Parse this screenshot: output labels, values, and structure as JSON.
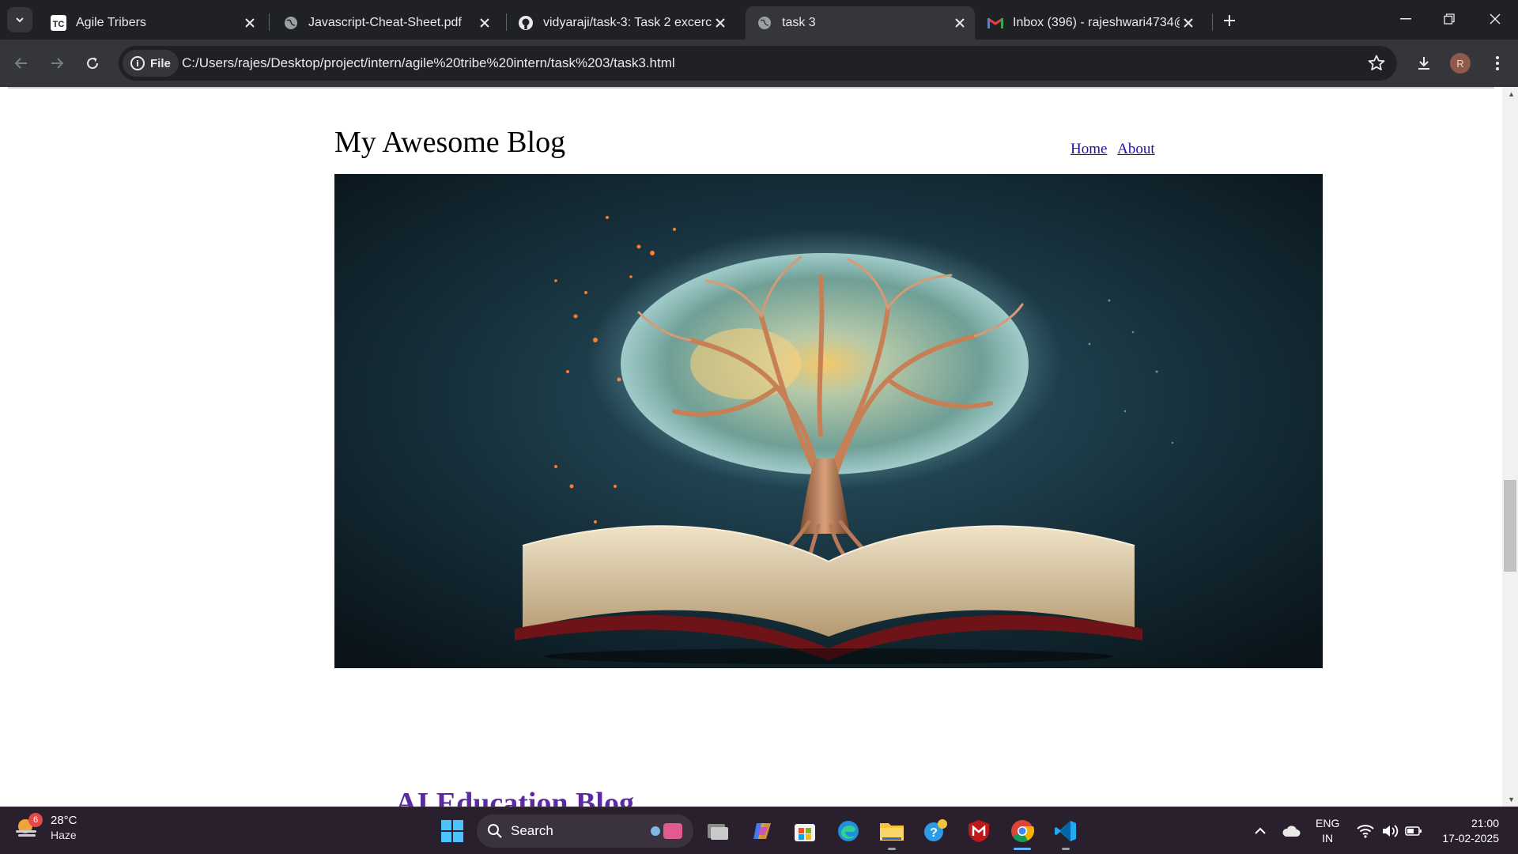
{
  "browser": {
    "tabs": [
      {
        "title": "Agile Tribers",
        "favicon": "tc-logo-icon"
      },
      {
        "title": "Javascript-Cheat-Sheet.pdf",
        "favicon": "globe-icon"
      },
      {
        "title": "vidyaraji/task-3: Task 2 excercise",
        "favicon": "github-icon"
      },
      {
        "title": "task 3",
        "favicon": "globe-icon",
        "active": true
      },
      {
        "title": "Inbox (396) - rajeshwari4734@g",
        "favicon": "gmail-icon"
      }
    ],
    "address": {
      "chip_label": "File",
      "url": "C:/Users/rajes/Desktop/project/intern/agile%20tribe%20intern/task%203/task3.html"
    },
    "profile_initial": "R"
  },
  "page": {
    "blog_title": "My Awesome Blog",
    "nav": [
      {
        "label": "Home"
      },
      {
        "label": "About"
      }
    ],
    "hero_alt": "Glowing tree growing from an open book",
    "post_title": "AI Education Blog"
  },
  "taskbar": {
    "weather": {
      "badge": "6",
      "temp": "28°C",
      "condition": "Haze"
    },
    "search_label": "Search",
    "lang": {
      "line1": "ENG",
      "line2": "IN"
    },
    "clock": {
      "time": "21:00",
      "date": "17-02-2025"
    }
  },
  "colors": {
    "tabstrip": "#202124",
    "toolbar": "#35363a",
    "link": "#1f0ea8",
    "post_title": "#5a2ba0",
    "taskbar": "#2a1f2c"
  }
}
